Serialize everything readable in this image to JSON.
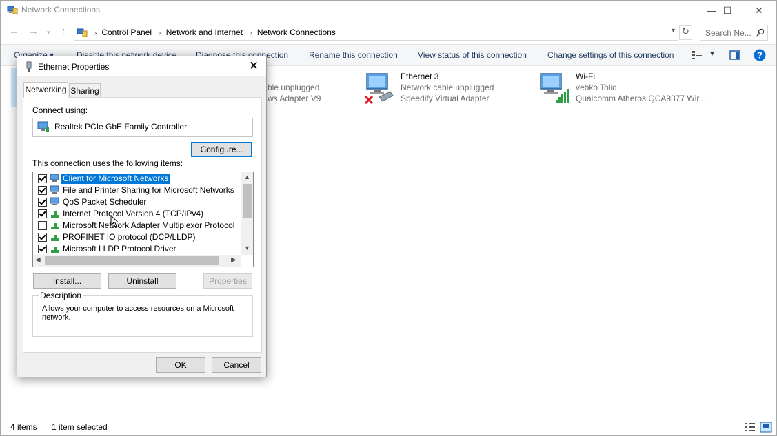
{
  "window": {
    "title": "Network Connections",
    "controls": {
      "minimize": "—",
      "maximize": "☐",
      "close": "✕"
    }
  },
  "address": {
    "breadcrumbs": [
      "Control Panel",
      "Network and Internet",
      "Network Connections"
    ],
    "search_placeholder": "Search Ne..."
  },
  "commandbar": {
    "organize": "Organize ▾",
    "items": [
      "Disable this network device",
      "Diagnose this connection",
      "Rename this connection",
      "View status of this connection",
      "Change settings of this connection"
    ]
  },
  "connections": [
    {
      "name": "",
      "status": "ble unplugged",
      "adapter": "ws Adapter V9",
      "icon": "ethernet-icon"
    },
    {
      "name": "Ethernet 3",
      "status": "Network cable unplugged",
      "adapter": "Speedify Virtual Adapter",
      "icon": "ethernet-disconnected-icon"
    },
    {
      "name": "Wi-Fi",
      "status": "vebko Tolid",
      "adapter": "Qualcomm Atheros QCA9377 Wir...",
      "icon": "wifi-icon"
    }
  ],
  "statusbar": {
    "items_count": "4 items",
    "selected": "1 item selected"
  },
  "dialog": {
    "title": "Ethernet Properties",
    "tabs": [
      "Networking",
      "Sharing"
    ],
    "connect_using_label": "Connect using:",
    "adapter": "Realtek PCIe GbE Family Controller",
    "configure": "Configure...",
    "items_label": "This connection uses the following items:",
    "items": [
      {
        "label": "Client for Microsoft Networks",
        "checked": true,
        "selected": true
      },
      {
        "label": "File and Printer Sharing for Microsoft Networks",
        "checked": true,
        "selected": false
      },
      {
        "label": "QoS Packet Scheduler",
        "checked": true,
        "selected": false
      },
      {
        "label": "Internet Protocol Version 4 (TCP/IPv4)",
        "checked": true,
        "selected": false
      },
      {
        "label": "Microsoft Network Adapter Multiplexor Protocol",
        "checked": false,
        "selected": false
      },
      {
        "label": "PROFINET IO protocol (DCP/LLDP)",
        "checked": true,
        "selected": false
      },
      {
        "label": "Microsoft LLDP Protocol Driver",
        "checked": true,
        "selected": false
      }
    ],
    "install": "Install...",
    "uninstall": "Uninstall",
    "properties": "Properties",
    "description_label": "Description",
    "description": "Allows your computer to access resources on a Microsoft network.",
    "ok": "OK",
    "cancel": "Cancel"
  },
  "colors": {
    "accent": "#0078d7",
    "link": "#1e3a5f"
  }
}
